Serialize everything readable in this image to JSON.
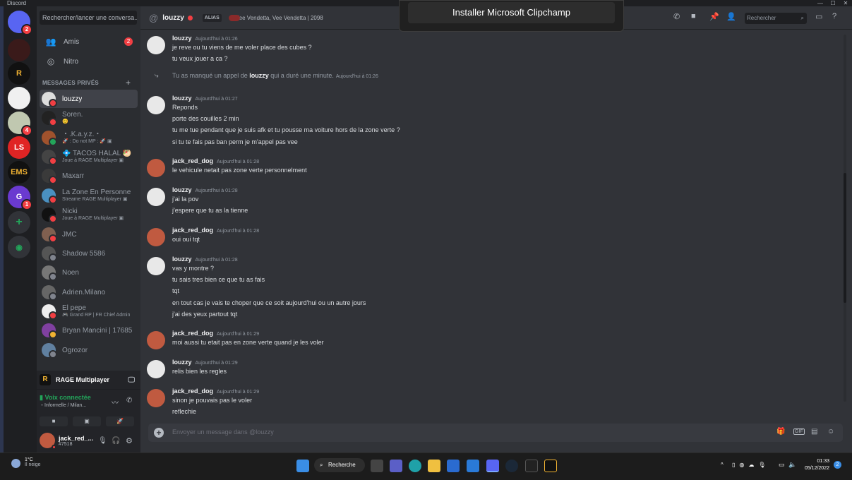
{
  "app_title": "Discord",
  "window_controls": [
    "—",
    "☐",
    "✕"
  ],
  "guilds": [
    {
      "name": "discord-home",
      "letter": "",
      "color": "#5865f2",
      "badge": "2"
    },
    {
      "name": "server-1",
      "letter": "",
      "color": "#3a1a1a",
      "badge": ""
    },
    {
      "name": "server-rage",
      "letter": "R",
      "color": "#111111",
      "badge": ""
    },
    {
      "name": "server-milano",
      "letter": "",
      "color": "#f0f0f0",
      "badge": ""
    },
    {
      "name": "server-4",
      "letter": "",
      "color": "#c0c8b0",
      "badge": "4"
    },
    {
      "name": "server-ls",
      "letter": "LS",
      "color": "#e02424",
      "badge": ""
    },
    {
      "name": "server-ems",
      "letter": "EMS",
      "color": "#111111",
      "badge": ""
    },
    {
      "name": "server-g",
      "letter": "G",
      "color": "#6a3ad0",
      "badge": "1"
    }
  ],
  "sidebar": {
    "search_placeholder": "Rechercher/lancer une conversa...",
    "friends_label": "Amis",
    "friends_badge": "2",
    "nitro_label": "Nitro",
    "dm_header": "MESSAGES PRIVÉS",
    "dms": [
      {
        "name": "louzzy",
        "sub": "",
        "status": "#f23f43",
        "avatar": "#ddd",
        "active": true
      },
      {
        "name": "Soren.",
        "sub": "😊",
        "status": "#f23f43",
        "avatar": "#222",
        "active": false
      },
      {
        "name": "・.K.a.y.z.・",
        "sub": "🚀 : Do not MP : 🚀 ▣",
        "status": "#23a55a",
        "avatar": "#a0522d",
        "active": false
      },
      {
        "name": "💠 TACOS HALAL 🥙",
        "sub": "Joue à RAGE Multiplayer ▣",
        "status": "#f23f43",
        "avatar": "#444",
        "active": false
      },
      {
        "name": "Maxarr",
        "sub": "",
        "status": "#f23f43",
        "avatar": "#3a3a3a",
        "active": false
      },
      {
        "name": "La Zone En Personne",
        "sub": "Streame RAGE Multiplayer ▣",
        "status": "#f23f43",
        "avatar": "#4a90c0",
        "active": false
      },
      {
        "name": "Nicki",
        "sub": "Joue à RAGE Multiplayer ▣",
        "status": "#f23f43",
        "avatar": "#111",
        "active": false
      },
      {
        "name": "JMC",
        "sub": "",
        "status": "#f23f43",
        "avatar": "#806050",
        "active": false
      },
      {
        "name": "Shadow 5586",
        "sub": "",
        "status": "#80848e",
        "avatar": "#555",
        "active": false
      },
      {
        "name": "Noen",
        "sub": "",
        "status": "#80848e",
        "avatar": "#777",
        "active": false
      },
      {
        "name": "Adrien.Milano",
        "sub": "",
        "status": "#80848e",
        "avatar": "#666",
        "active": false
      },
      {
        "name": "El pepe",
        "sub": "🎮 Grand RP | FR Chief Admin",
        "status": "#f23f43",
        "avatar": "#eee",
        "active": false
      },
      {
        "name": "Bryan Mancini | 17685",
        "sub": "",
        "status": "#f0b232",
        "avatar": "#8040a0",
        "active": false
      },
      {
        "name": "Ogrozor",
        "sub": "",
        "status": "#80848e",
        "avatar": "#6080a0",
        "active": false
      }
    ],
    "rage_label": "RAGE Multiplayer",
    "voice_connected": "Voix connectée",
    "voice_channel": "・Informelle / Milan...",
    "user_name": "jack_red_...",
    "user_tag": "#7518"
  },
  "chat": {
    "at_symbol": "@",
    "title": "louzzy",
    "alias_label": "ALIAS",
    "alias_text": "Vee Vendetta, Vee Vendetta | 2098",
    "search_placeholder": "Rechercher",
    "composer_placeholder": "Envoyer un message dans @louzzy",
    "messages": [
      {
        "user": "louzzy",
        "ts": "Aujourd'hui à 01:26",
        "avatar": "#e8e8e8",
        "lines": [
          "je reve ou tu viens de me voler place des cubes ?",
          "tu veux jouer a ca ?"
        ]
      },
      {
        "system": true,
        "text_pre": "Tu as manqué un appel de ",
        "text_user": "louzzy",
        "text_post": " qui a duré une minute.",
        "ts": "Aujourd'hui à 01:26"
      },
      {
        "user": "louzzy",
        "ts": "Aujourd'hui à 01:27",
        "avatar": "#e8e8e8",
        "lines": [
          "Reponds",
          "porte des couilles 2 min",
          "tu me tue pendant que je suis afk et tu pousse ma voiture hors de la zone verte ?",
          "si tu te fais pas ban perm je m'appel pas vee"
        ]
      },
      {
        "user": "jack_red_dog",
        "ts": "Aujourd'hui à 01:28",
        "avatar": "#c05a40",
        "lines": [
          "le vehicule netait pas zone verte personnelment"
        ]
      },
      {
        "user": "louzzy",
        "ts": "Aujourd'hui à 01:28",
        "avatar": "#e8e8e8",
        "lines": [
          "j'ai la pov",
          "j'espere que tu as la tienne"
        ]
      },
      {
        "user": "jack_red_dog",
        "ts": "Aujourd'hui à 01:28",
        "avatar": "#c05a40",
        "lines": [
          "oui oui tqt"
        ]
      },
      {
        "user": "louzzy",
        "ts": "Aujourd'hui à 01:28",
        "avatar": "#e8e8e8",
        "lines": [
          "vas y montre ?",
          "tu sais tres bien ce que tu as fais",
          "tqt",
          "en tout cas je vais te choper que ce soit aujourd'hui ou un autre jours",
          "j'ai des yeux partout tqt"
        ]
      },
      {
        "user": "jack_red_dog",
        "ts": "Aujourd'hui à 01:29",
        "avatar": "#c05a40",
        "lines": [
          "moi aussi tu etait pas en zone verte quand je les voler"
        ]
      },
      {
        "user": "louzzy",
        "ts": "Aujourd'hui à 01:29",
        "avatar": "#e8e8e8",
        "lines": [
          "relis bien les regles"
        ]
      },
      {
        "user": "jack_red_dog",
        "ts": "Aujourd'hui à 01:29",
        "avatar": "#c05a40",
        "lines": [
          "sinon je pouvais pas le voler",
          "reflechie"
        ]
      }
    ]
  },
  "toast": {
    "label": "Installer Microsoft Clipchamp"
  },
  "taskbar": {
    "weather_temp": "1°C",
    "weather_desc": "Il neige",
    "search_label": "Recherche",
    "time": "01:33",
    "date": "05/12/2022",
    "notif_count": "2"
  }
}
